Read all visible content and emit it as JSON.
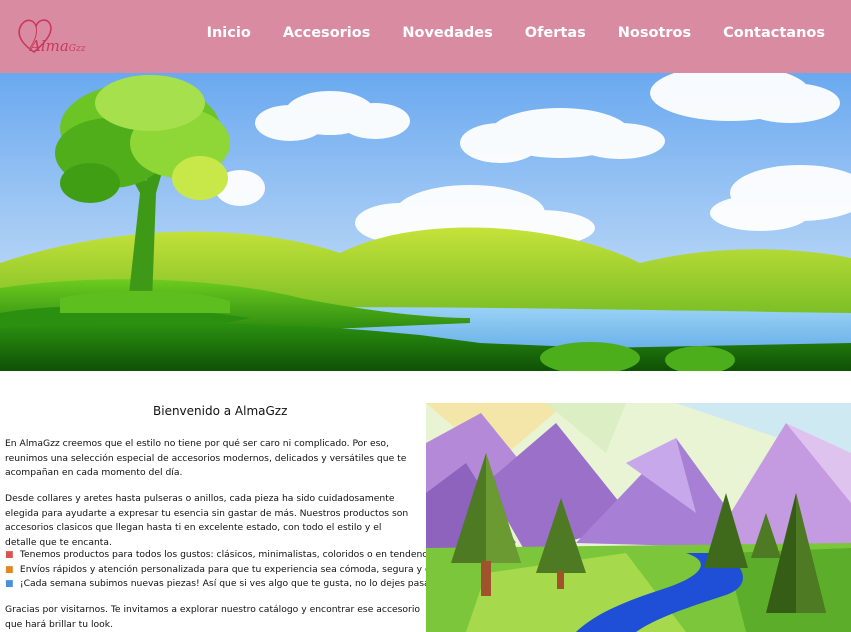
{
  "brand": {
    "logo_text": "Alma",
    "logo_text_small": "Gzz"
  },
  "nav": {
    "items": [
      {
        "label": "Inicio"
      },
      {
        "label": "Accesorios"
      },
      {
        "label": "Novedades"
      },
      {
        "label": "Ofertas"
      },
      {
        "label": "Nosotros"
      },
      {
        "label": "Contactanos"
      }
    ]
  },
  "colors": {
    "navbar": "#d98ca1",
    "logo": "#c9385c",
    "nav_text": "#ffffff"
  },
  "main": {
    "title": "Bienvenido a AlmaGzz",
    "paragraph1": "En AlmaGzz creemos que el estilo no tiene por qué ser caro ni complicado. Por eso, reunimos una selección especial de accesorios modernos, delicados y versátiles que te acompañan en cada momento del día.",
    "paragraph2": "Desde collares y aretes hasta pulseras o anillos, cada pieza ha sido cuidadosamente elegida para ayudarte a expresar tu esencia sin gastar de más. Nuestros productos son accesorios clasicos que llegan hasta ti en excelente estado, con todo el estilo y el detalle que te encanta.",
    "features": [
      {
        "icon": "gift-icon",
        "text": "Tenemos productos para todos los gustos: clásicos, minimalistas, coloridos o en tendencia."
      },
      {
        "icon": "truck-icon",
        "text": "Envíos rápidos y atención personalizada para que tu experiencia sea cómoda, segura y confiable."
      },
      {
        "icon": "shopping-bag-icon",
        "text": "¡Cada semana subimos nuevas piezas! Así que si ves algo que te gusta, no lo dejes pasar."
      }
    ],
    "closing": "Gracias por visitarnos. Te invitamos a explorar nuestro catálogo y encontrar ese accesorio que hará brillar tu look."
  }
}
